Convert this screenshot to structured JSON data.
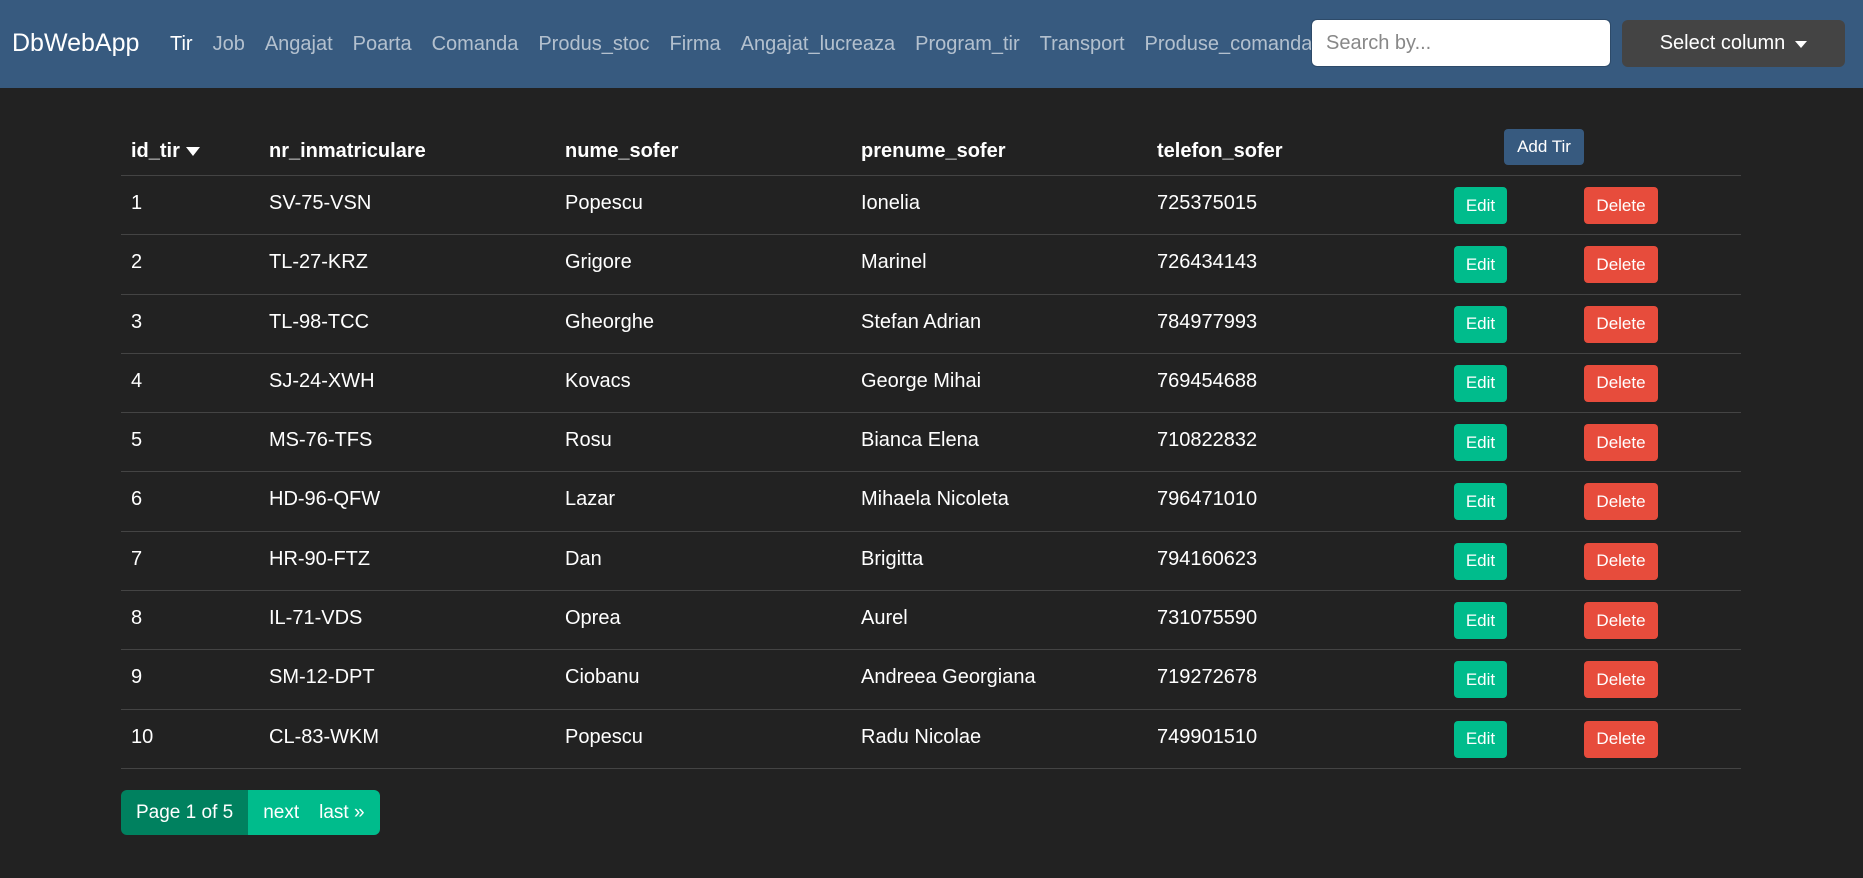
{
  "app": {
    "brand": "DbWebApp"
  },
  "nav": {
    "links": [
      "Tir",
      "Job",
      "Angajat",
      "Poarta",
      "Comanda",
      "Produs_stoc",
      "Firma",
      "Angajat_lucreaza",
      "Program_tir",
      "Transport",
      "Produse_comanda"
    ],
    "active": "Tir"
  },
  "search": {
    "placeholder": "Search by...",
    "value": ""
  },
  "select_column": {
    "label": "Select column"
  },
  "table": {
    "columns": [
      "id_tir",
      "nr_inmatriculare",
      "nume_sofer",
      "prenume_sofer",
      "telefon_sofer"
    ],
    "sort_column": "id_tir",
    "sort_direction": "desc-icon",
    "add_label": "Add Tir",
    "edit_label": "Edit",
    "delete_label": "Delete",
    "rows": [
      [
        "1",
        "SV-75-VSN",
        "Popescu",
        "Ionelia",
        "725375015"
      ],
      [
        "2",
        "TL-27-KRZ",
        "Grigore",
        "Marinel",
        "726434143"
      ],
      [
        "3",
        "TL-98-TCC",
        "Gheorghe",
        "Stefan Adrian",
        "784977993"
      ],
      [
        "4",
        "SJ-24-XWH",
        "Kovacs",
        "George Mihai",
        "769454688"
      ],
      [
        "5",
        "MS-76-TFS",
        "Rosu",
        "Bianca Elena",
        "710822832"
      ],
      [
        "6",
        "HD-96-QFW",
        "Lazar",
        "Mihaela Nicoleta",
        "796471010"
      ],
      [
        "7",
        "HR-90-FTZ",
        "Dan",
        "Brigitta",
        "794160623"
      ],
      [
        "8",
        "IL-71-VDS",
        "Oprea",
        "Aurel",
        "731075590"
      ],
      [
        "9",
        "SM-12-DPT",
        "Ciobanu",
        "Andreea Georgiana",
        "719272678"
      ],
      [
        "10",
        "CL-83-WKM",
        "Popescu",
        "Radu Nicolae",
        "749901510"
      ]
    ]
  },
  "pagination": {
    "info": "Page 1 of 5",
    "next_label": "next",
    "last_label": "last »"
  },
  "colors": {
    "navbar": "#375a7f",
    "background": "#222222",
    "edit": "#00bc8c",
    "delete": "#e74c3c",
    "page_info": "#00815f",
    "select_button": "#444444"
  }
}
